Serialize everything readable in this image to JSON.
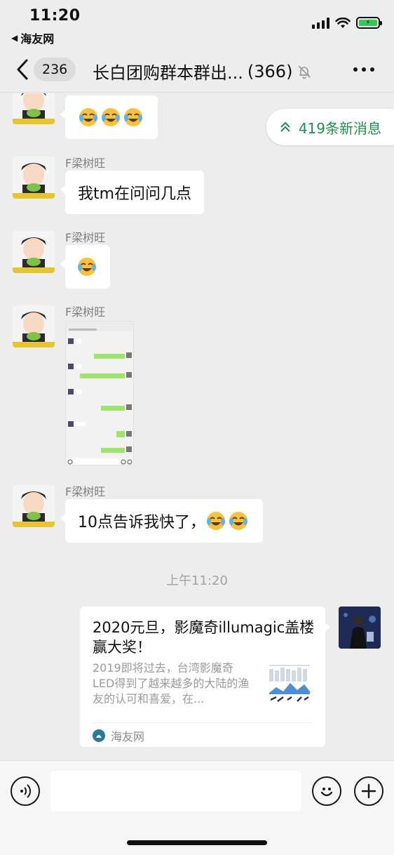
{
  "status_bar": {
    "time": "11:20",
    "back_app": "海友网"
  },
  "nav": {
    "back_count": "236",
    "title": "长白团购群本群出...",
    "member_count": "(366)"
  },
  "new_messages_banner": {
    "label": "419条新消息"
  },
  "messages": [
    {
      "sender": "",
      "text": "",
      "emoji_count": 3
    },
    {
      "sender": "F梁树旺",
      "text": "我tm在问问几点"
    },
    {
      "sender": "F梁树旺",
      "text": "",
      "emoji_count": 1
    },
    {
      "sender": "F梁树旺",
      "type": "image"
    },
    {
      "sender": "F梁树旺",
      "text": "10点告诉我快了，",
      "emoji_count": 2
    }
  ],
  "timestamp": "上午11:20",
  "link_card": {
    "title": "2020元旦，影魔奇illumagic盖楼赢大奖！",
    "description": "2019即将过去，台湾影魔奇LED得到了越来越多的大陆的渔友的认可和喜爱，在...",
    "source": "海友网"
  },
  "colors": {
    "background": "#ededed",
    "accent_green": "#1f8f4e",
    "bubble": "#ffffff"
  }
}
